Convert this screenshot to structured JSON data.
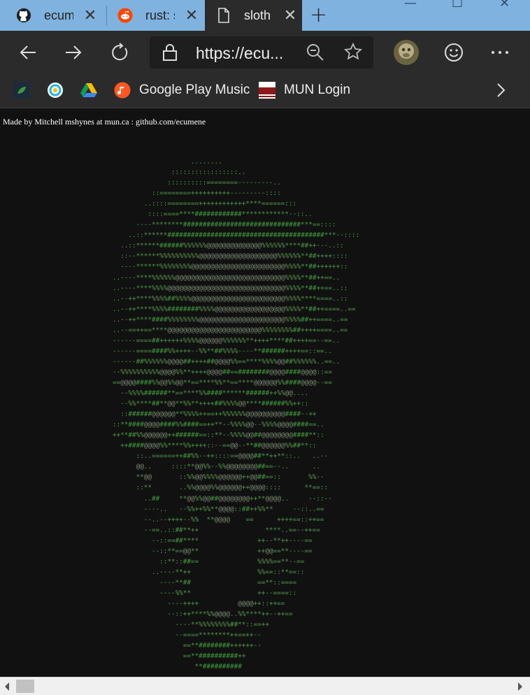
{
  "tabs": [
    {
      "label": "ecum",
      "icon": "github-icon"
    },
    {
      "label": "rust: s",
      "icon": "reddit-icon"
    },
    {
      "label": "sloth",
      "icon": "page-icon",
      "active": true
    }
  ],
  "address_bar": {
    "url": "https://ecu..."
  },
  "bookmarks": [
    {
      "label": "",
      "icon": "leaf-icon"
    },
    {
      "label": "",
      "icon": "circle-app-icon"
    },
    {
      "label": "",
      "icon": "google-drive-icon"
    },
    {
      "label": "Google Play Music",
      "icon": "play-music-icon"
    },
    {
      "label": "MUN Login",
      "icon": "mun-icon"
    }
  ],
  "page": {
    "credit": "Made by Mitchell mshynes at mun.ca : github.com/ecumene",
    "ascii_art": "                    ........\n               :::::::::::::::::..\n              ::::::::::========---------..\n          ::========++++++++++---------::::\n        ..::::========++++++++++++****======:::\n         ::::====****############************--::..\n      ----********##############################***==::::\n    ..::******########################################***--::::\n  ..::******######%%%%%%@@@@@@@@@@@@@@%%%%%%****##++---..::\n  ::--******%%%%%%%%%%@@@@@@@@@@@@@@@@@@@@%%%%%%**##++++::::\n  ----******%%%%%%%%@@@@@@@@@@@@@@@@@@@@@@@@%%%%**##++++++::\n..----****%%%%%%@@@@@@@@@@@@@@@@@@@@@@@@@@@@%%%%**##++==..\n..----****%%%%@@@@@@@@@@@@@@@@@@@@@@@@@@@@@@%%%%**##++==..::\n..--++****%%%%##%%%%@@@@@@@@@@@@@@@@@@@@@@@@%%%%****====..::\n..--++****%%%%########%%%%@@@@@@@@@@@@@@@@@@%%%%**##++====..==\n..--++****####%%%%%%%%@@@@@@@@@@@@@@@@@@@@@@%%%%##++====..==\n..--==++==****@@@@@@@@@@@@@@@@@@@@@@@@%%%%%%%%##++++====..==\n------====##++++++%%%%@@@@@@%%%%%%**++++****##++++==--==..\n------====####%%++++--%%**##%%%%----**######++++==::==..\n------##%%%%%%@@@@##++++##@@@@%%==****%%%%@@##%%%%%%..==..\n--%%%%%%%%%%@@@@%%**++++@@@@##==########@@@@####@@@@::==\n==@@@@####%%@@%%@@**==****%%**==****@@@@@@%%####@@@@--==\n  --%%%%######**==****%%####******######++%%@@....\n  --%%****##**@@**%%**++++##%%%%@@****######%%++::\n  ::######@@@@@@**%%%%++==++%%%%%%@@@@@@@@@@####--++\n::**####@@@@####%%####==++**--%%%%@@--%%%%@@@@####==..\n++**##%%@@@@@@++######==::**--%%%%@@##@@@@@@@@####**::\n  ++####@@@@%%****%%++++::--==@@--**##@@@@@@%%##**::\n      ::..======++##%%--++::::==@@@@##**++**::..   ..--\n      @@..     ::::**@@%%--%%@@@@@@@@##==--..      ..\n      **@@       ::%%@@%%%%@@@@@@++@@##==::       %%--\n      ::**       ..%%@@@@%%@@@@@@++@@@@::::      **==::\n        ..##     **@@%%@@##@@@@@@@@++**@@@@..     --::--\n        ----..   --%%++%%**@@@@::##++%%**     --::..==\n        --..--++++--%%  **@@@@    ==      ++++==::++==\n        --==..::##**++                 ****..==--++==\n          --::==##****               ++--**++----==\n          --::**==@@**               ++@@==**----==\n            ::**::##==               %%%%==**--==\n          ..----**++                 %%==::**==::\n            ----**##                 ==**::====\n            ----%%**                 ++--====::\n              ----++++          @@@@++::++==\n              --::++****%%@@@@..%%****++--++==\n                ----**%%%%%%%%##**::==++\n                --====********++==++--\n                  ==**########++++++--\n                  ==**##########++\n                     **##########"
  }
}
